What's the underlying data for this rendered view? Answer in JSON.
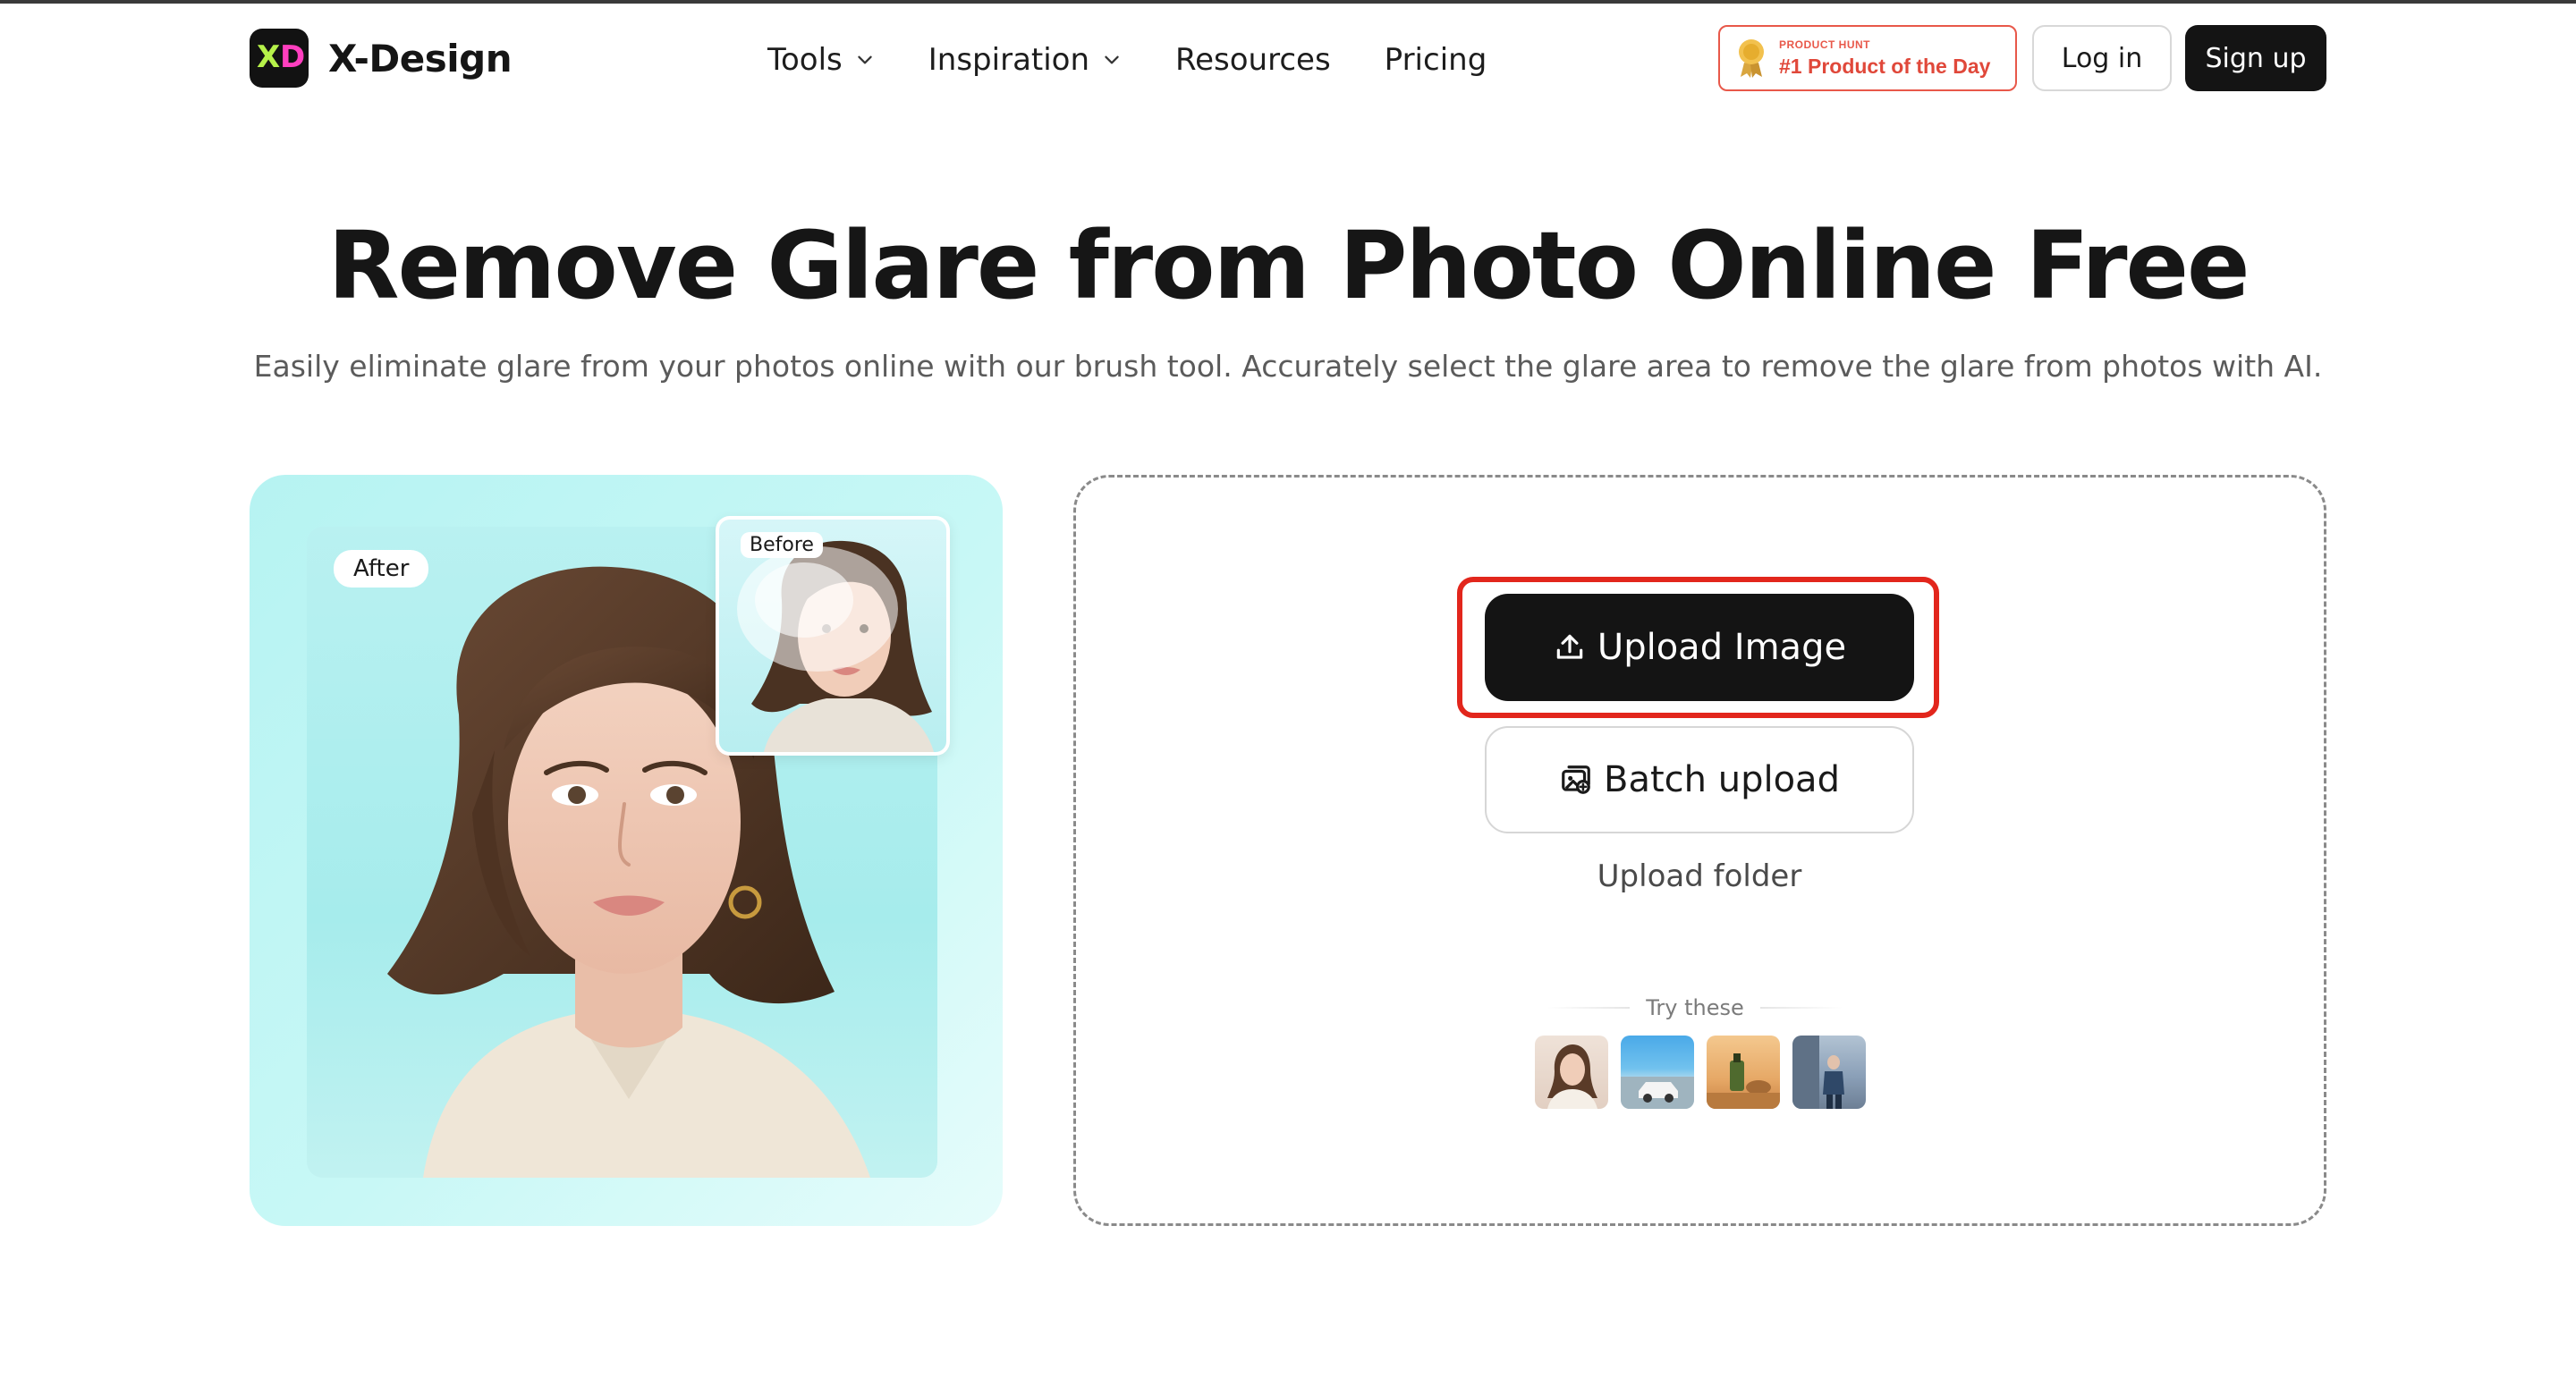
{
  "brand": {
    "name": "X-Design"
  },
  "nav": {
    "items": [
      {
        "label": "Tools",
        "dropdown": true
      },
      {
        "label": "Inspiration",
        "dropdown": true
      },
      {
        "label": "Resources",
        "dropdown": false
      },
      {
        "label": "Pricing",
        "dropdown": false
      }
    ]
  },
  "product_hunt": {
    "small": "PRODUCT HUNT",
    "big": "#1 Product of the Day"
  },
  "auth": {
    "login": "Log in",
    "signup": "Sign up"
  },
  "hero": {
    "title": "Remove Glare from Photo Online Free",
    "subtitle": "Easily eliminate glare from your photos online with our brush tool. Accurately select the glare area to remove the glare from photos with AI."
  },
  "preview": {
    "after_label": "After",
    "before_label": "Before"
  },
  "upload": {
    "upload_image": "Upload Image",
    "batch_upload": "Batch upload",
    "upload_folder": "Upload folder",
    "try_these": "Try these"
  },
  "colors": {
    "accent_dark": "#141414",
    "highlight_red": "#e2261c",
    "badge_red": "#e8584a",
    "preview_bg": "#b6f3f2"
  }
}
